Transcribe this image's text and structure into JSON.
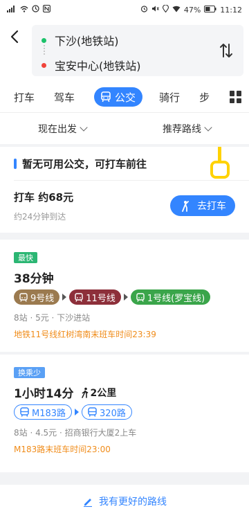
{
  "status_bar": {
    "left_glyphs": [
      "signal-icon",
      "wifi-icon",
      "vpn-icon",
      "nfc-icon"
    ],
    "battery": "47%",
    "time": "11:12"
  },
  "route": {
    "origin": "下沙(地铁站)",
    "destination": "宝安中心(地铁站)"
  },
  "mode_tabs": {
    "taxi": "打车",
    "drive": "驾车",
    "transit": "公交",
    "ride": "骑行",
    "walk": "步"
  },
  "filters": {
    "depart": "现在出发",
    "sort": "推荐路线"
  },
  "taxi_card": {
    "notice": "暂无可用公交，可打车前往",
    "title": "打车  约68元",
    "subtitle": "约24分钟到达",
    "button": "去打车"
  },
  "routes": [
    {
      "tag": "最快",
      "time": "38分钟",
      "lines": [
        "9号线",
        "11号线",
        "1号线(罗宝线)"
      ],
      "meta": "8站 · 5元 · 下沙进站",
      "warning": "地铁11号线红树湾南末班车时间23:39"
    },
    {
      "tag": "换乘少",
      "time": "1小时14分",
      "walk": "2公里",
      "lines": [
        "M183路",
        "320路"
      ],
      "meta": "8站 · 4.5元 · 招商银行大厦2上车",
      "warning": "M183路末班车时间23:00"
    }
  ],
  "bottom": {
    "label": "我有更好的路线"
  },
  "colors": {
    "accent": "#3385ff",
    "fastest_tag": "#2bb673",
    "fewer_transfers_tag": "#5aa0f5",
    "warning": "#f08c1a",
    "line_9": "#9b7a4f",
    "line_11": "#8d2f3a",
    "line_1": "#3aa54a"
  }
}
